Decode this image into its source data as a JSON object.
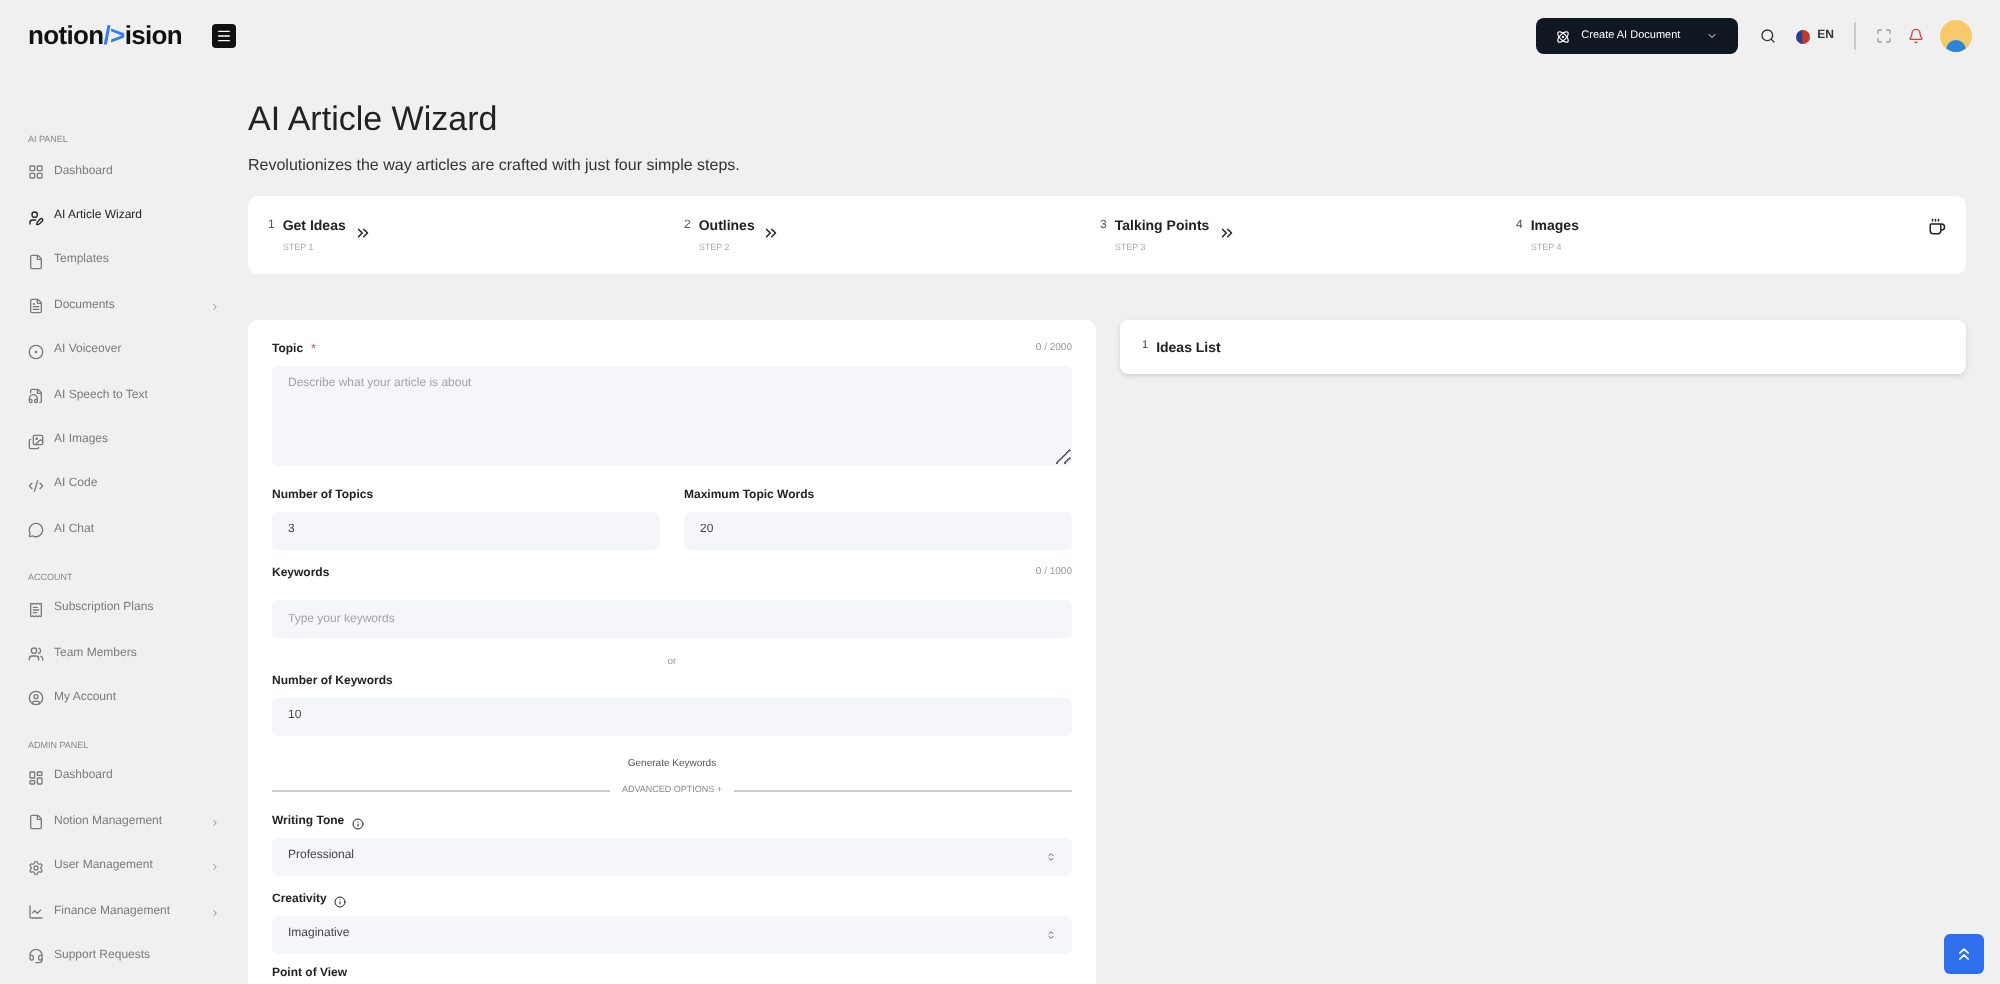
{
  "header": {
    "logo_parts": [
      "notion",
      "/>",
      "ision"
    ],
    "create_button": "Create AI Document",
    "language": "EN"
  },
  "sidebar": {
    "sections": [
      {
        "heading": "AI PANEL",
        "items": [
          {
            "label": "Dashboard",
            "selected": false,
            "has_submenu": false
          },
          {
            "label": "AI Article Wizard",
            "selected": true,
            "has_submenu": false
          },
          {
            "label": "Templates",
            "selected": false,
            "has_submenu": false
          },
          {
            "label": "Documents",
            "selected": false,
            "has_submenu": true
          },
          {
            "label": "AI Voiceover",
            "selected": false,
            "has_submenu": false
          },
          {
            "label": "AI Speech to Text",
            "selected": false,
            "has_submenu": false
          },
          {
            "label": "AI Images",
            "selected": false,
            "has_submenu": false
          },
          {
            "label": "AI Code",
            "selected": false,
            "has_submenu": false
          },
          {
            "label": "AI Chat",
            "selected": false,
            "has_submenu": false
          }
        ]
      },
      {
        "heading": "ACCOUNT",
        "items": [
          {
            "label": "Subscription Plans",
            "selected": false,
            "has_submenu": false
          },
          {
            "label": "Team Members",
            "selected": false,
            "has_submenu": false
          },
          {
            "label": "My Account",
            "selected": false,
            "has_submenu": false
          }
        ]
      },
      {
        "heading": "ADMIN PANEL",
        "items": [
          {
            "label": "Dashboard",
            "selected": false,
            "has_submenu": false
          },
          {
            "label": "Notion Management",
            "selected": false,
            "has_submenu": true
          },
          {
            "label": "User Management",
            "selected": false,
            "has_submenu": true
          },
          {
            "label": "Finance Management",
            "selected": false,
            "has_submenu": true
          },
          {
            "label": "Support Requests",
            "selected": false,
            "has_submenu": false
          }
        ]
      }
    ]
  },
  "page": {
    "title": "AI Article Wizard",
    "subtitle": "Revolutionizes the way articles are crafted with just four simple steps."
  },
  "steps": [
    {
      "number": "1",
      "title": "Get Ideas",
      "subtitle": "STEP 1"
    },
    {
      "number": "2",
      "title": "Outlines",
      "subtitle": "STEP 2"
    },
    {
      "number": "3",
      "title": "Talking Points",
      "subtitle": "STEP 3"
    },
    {
      "number": "4",
      "title": "Images",
      "subtitle": "STEP 4"
    }
  ],
  "form": {
    "topic": {
      "label": "Topic",
      "required_mark": "*",
      "counter": "0 / 2000",
      "placeholder": "Describe what your article is about"
    },
    "number_of_topics": {
      "label": "Number of Topics",
      "value": "3"
    },
    "maximum_topic_words": {
      "label": "Maximum Topic Words",
      "value": "20"
    },
    "keywords": {
      "label": "Keywords",
      "counter": "0 / 1000",
      "placeholder": "Type your keywords"
    },
    "or_text": "or",
    "number_of_keywords": {
      "label": "Number of Keywords",
      "value": "10"
    },
    "generate_link": "Generate Keywords",
    "advanced_toggle": "ADVANCED OPTIONS +",
    "selects": [
      {
        "label": "Writing Tone",
        "value": "Professional"
      },
      {
        "label": "Creativity",
        "value": "Imaginative"
      }
    ],
    "next_label": "Point of View"
  },
  "ideas_card": {
    "number": "1",
    "title": "Ideas List"
  }
}
